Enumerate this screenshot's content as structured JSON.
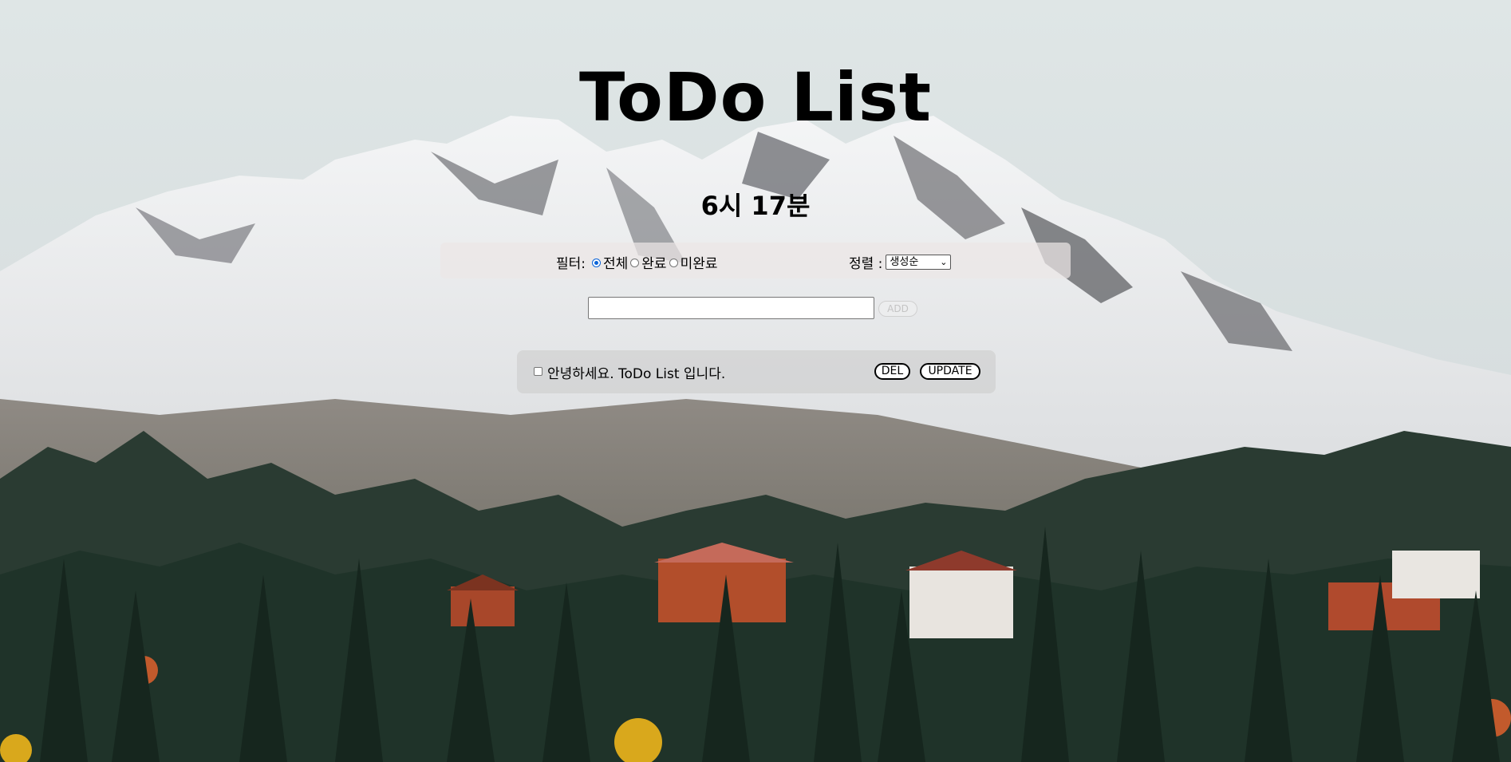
{
  "header": {
    "title": "ToDo List",
    "clock": "6시 17분"
  },
  "controls": {
    "filter_label": "필터:",
    "filter_options": [
      {
        "label": "전체",
        "checked": true
      },
      {
        "label": "완료",
        "checked": false
      },
      {
        "label": "미완료",
        "checked": false
      }
    ],
    "sort_label": "정렬 :",
    "sort_selected": "생성순"
  },
  "input": {
    "value": "",
    "add_label": "ADD"
  },
  "todos": [
    {
      "text": "안녕하세요. ToDo List 입니다.",
      "checked": false,
      "delete_label": "DEL",
      "update_label": "UPDATE"
    }
  ],
  "background": {
    "sky_color": "#dfe6e6",
    "snow_color": "#f2f3f4",
    "rock_color": "#6e6f73",
    "forest_color": "#1f3329",
    "accent_colors": [
      "#a8472a",
      "#d9a81c",
      "#c25a2c"
    ]
  }
}
